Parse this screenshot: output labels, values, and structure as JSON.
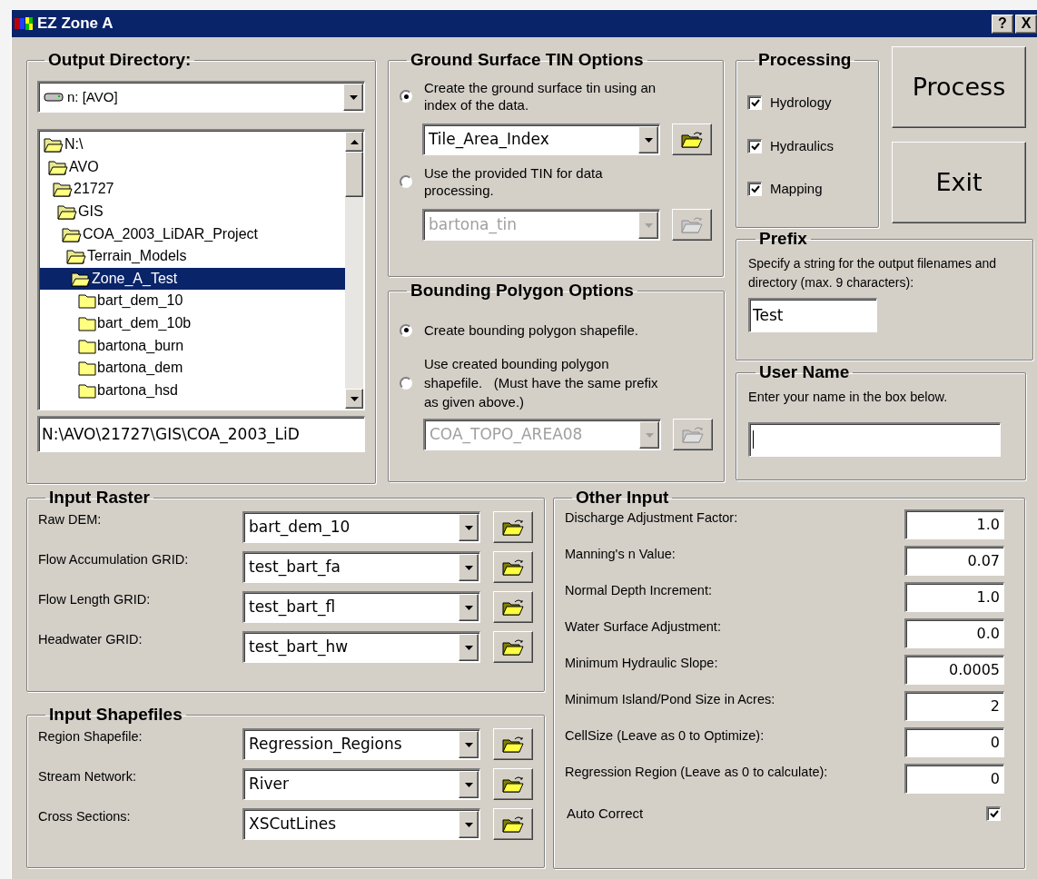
{
  "window": {
    "title": "EZ Zone A",
    "help_button": "?",
    "close_button": "X"
  },
  "output_directory": {
    "title": "Output Directory:",
    "drive": "n: [AVO]",
    "path": "N:\\AVO\\21727\\GIS\\COA_2003_LiD",
    "tree": [
      {
        "label": "N:\\",
        "expanded": true,
        "selected": false,
        "children": [
          {
            "label": "AVO",
            "expanded": true,
            "selected": false,
            "children": [
              {
                "label": "21727",
                "expanded": true,
                "selected": false,
                "children": [
                  {
                    "label": "GIS",
                    "expanded": true,
                    "selected": false,
                    "children": [
                      {
                        "label": "COA_2003_LiDAR_Project",
                        "expanded": true,
                        "selected": false,
                        "children": [
                          {
                            "label": "Terrain_Models",
                            "expanded": true,
                            "selected": false,
                            "children": [
                              {
                                "label": "Zone_A_Test",
                                "expanded": true,
                                "selected": true,
                                "children": [
                                  {
                                    "label": "bart_dem_10",
                                    "expanded": false,
                                    "selected": false
                                  },
                                  {
                                    "label": "bart_dem_10b",
                                    "expanded": false,
                                    "selected": false
                                  },
                                  {
                                    "label": "bartona_burn",
                                    "expanded": false,
                                    "selected": false
                                  },
                                  {
                                    "label": "bartona_dem",
                                    "expanded": false,
                                    "selected": false
                                  },
                                  {
                                    "label": "bartona_hsd",
                                    "expanded": false,
                                    "selected": false
                                  }
                                ]
                              }
                            ]
                          }
                        ]
                      }
                    ]
                  }
                ]
              }
            ]
          }
        ]
      }
    ]
  },
  "ground_surface": {
    "title": "Ground Surface TIN Options",
    "options": [
      {
        "label": "Create the ground surface tin using an index of the data.",
        "selected": true,
        "combo": {
          "value": "Tile_Area_Index",
          "disabled": false
        }
      },
      {
        "label": "Use the provided TIN for data processing.",
        "selected": false,
        "combo": {
          "value": "bartona_tin",
          "disabled": true
        }
      }
    ]
  },
  "bounding_polygon": {
    "title": "Bounding Polygon Options",
    "options": [
      {
        "label": "Create bounding polygon shapefile.",
        "selected": true
      },
      {
        "label": "Use created bounding polygon shapefile.   (Must have the same prefix as given above.)",
        "selected": false,
        "combo": {
          "value": "COA_TOPO_AREA08",
          "disabled": true
        }
      }
    ]
  },
  "processing": {
    "title": "Processing",
    "items": [
      {
        "label": "Hydrology",
        "checked": true
      },
      {
        "label": "Hydraulics",
        "checked": true
      },
      {
        "label": "Mapping",
        "checked": true
      }
    ]
  },
  "buttons": [
    "Process",
    "Exit"
  ],
  "prefix": {
    "title": "Prefix",
    "text": "Specify a string for the output filenames and directory (max. 9 characters):",
    "value": "Test"
  },
  "user_name": {
    "title": "User Name",
    "text": "Enter your name in the box below."
  },
  "input_raster": {
    "title": "Input Raster",
    "rows": [
      {
        "label": "Raw DEM:",
        "value": "bart_dem_10"
      },
      {
        "label": "Flow Accumulation GRID:",
        "value": "test_bart_fa"
      },
      {
        "label": "Flow Length GRID:",
        "value": "test_bart_fl"
      },
      {
        "label": "Headwater GRID:",
        "value": "test_bart_hw"
      }
    ]
  },
  "input_shapefiles": {
    "title": "Input Shapefiles",
    "rows": [
      {
        "label": "Region Shapefile:",
        "value": "Regression_Regions"
      },
      {
        "label": "Stream Network:",
        "value": "River"
      },
      {
        "label": "Cross Sections:",
        "value": "XSCutLines"
      }
    ]
  },
  "other_input": {
    "title": "Other Input",
    "fields": [
      {
        "label": "Discharge Adjustment Factor:",
        "value": "1.0"
      },
      {
        "label": "Manning's n Value:",
        "value": "0.07"
      },
      {
        "label": "Normal Depth Increment:",
        "value": "1.0"
      },
      {
        "label": "Water Surface Adjustment:",
        "value": "0.0"
      },
      {
        "label": "Minimum Hydraulic Slope:",
        "value": "0.0005"
      },
      {
        "label": "Minimum Island/Pond Size in Acres:",
        "value": "2"
      },
      {
        "label": "CellSize (Leave as 0 to Optimize):",
        "value": "0"
      },
      {
        "label": "Regression Region (Leave as 0 to calculate):",
        "value": "0"
      }
    ],
    "auto_correct": {
      "label": "Auto Correct",
      "checked": true
    }
  }
}
